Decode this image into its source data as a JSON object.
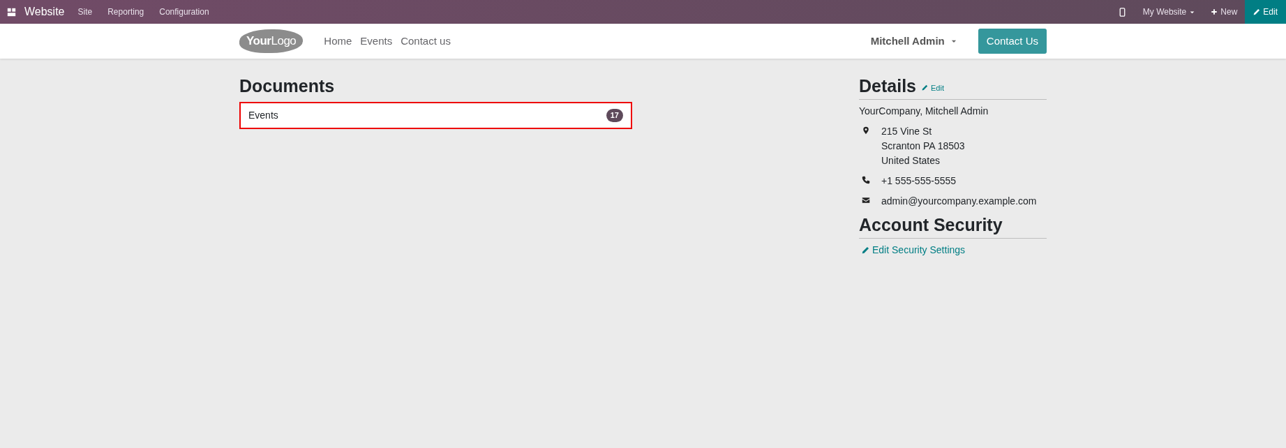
{
  "top_bar": {
    "app_name": "Website",
    "menu": [
      "Site",
      "Reporting",
      "Configuration"
    ],
    "website_switcher": "My Website",
    "new_button": "New",
    "edit_button": "Edit"
  },
  "navbar": {
    "logo": "**Your**Logo",
    "links": [
      "Home",
      "Events",
      "Contact us"
    ],
    "user": "Mitchell Admin",
    "cta": "Contact Us"
  },
  "documents": {
    "title": "Documents",
    "items": [
      {
        "label": "Events",
        "count": "17",
        "highlighted": true
      }
    ]
  },
  "details": {
    "title": "Details",
    "edit_link": "Edit",
    "name": "YourCompany, Mitchell Admin",
    "fields": [
      {
        "kind": "address",
        "lines": [
          "215 Vine St",
          "Scranton PA 18503",
          "United States"
        ]
      },
      {
        "kind": "phone",
        "lines": [
          "+1 555-555-5555"
        ]
      },
      {
        "kind": "email",
        "lines": [
          "admin@yourcompany.example.com"
        ]
      }
    ]
  },
  "security": {
    "title": "Account Security",
    "link": "Edit Security Settings"
  }
}
